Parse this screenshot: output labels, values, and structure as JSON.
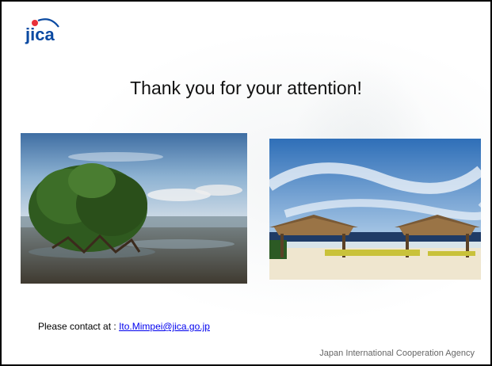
{
  "logo": {
    "text": "jica",
    "icon": "jica-logo"
  },
  "title": "Thank you for your attention!",
  "photos": [
    {
      "name": "mangrove-photo",
      "icon": "mangrove-beach-image"
    },
    {
      "name": "beach-huts-photo",
      "icon": "beach-huts-image"
    }
  ],
  "contact": {
    "label": "Please contact at : ",
    "email": "Ito.Mimpei@jica.go.jp"
  },
  "footer": "Japan International Cooperation Agency"
}
